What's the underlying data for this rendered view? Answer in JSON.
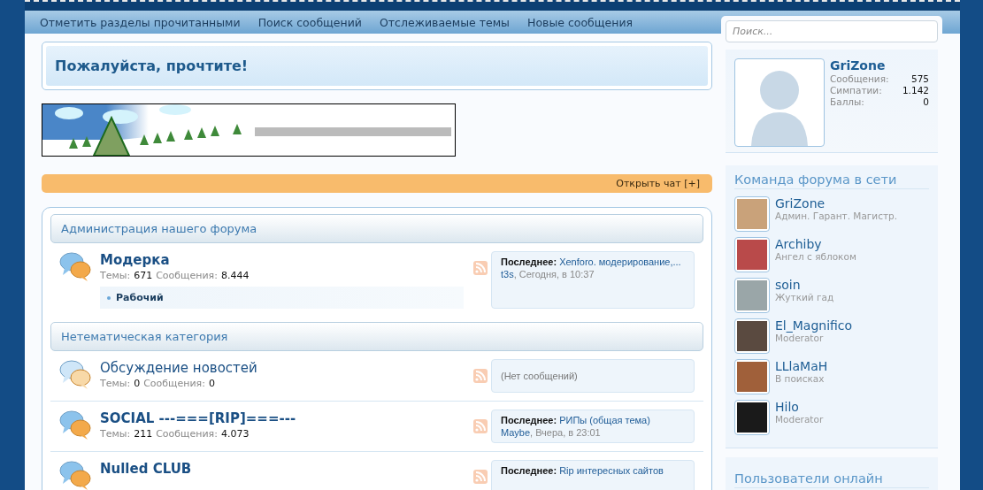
{
  "nav": [
    "Отметить разделы прочитанными",
    "Поиск сообщений",
    "Отслеживаемые темы",
    "Новые сообщения"
  ],
  "notice": {
    "title": "Пожалуйста, прочтите!"
  },
  "chat_button": "Открыть чат [+]",
  "categories": [
    {
      "title": "Администрация нашего форума",
      "nodes": [
        {
          "title": "Модерка",
          "unread": true,
          "stats": [
            {
              "label": "Темы:",
              "value": "671"
            },
            {
              "label": "Сообщения:",
              "value": "8.444"
            }
          ],
          "subforums": [
            "Рабочий"
          ],
          "last_post": {
            "prefix": "Последнее:",
            "title": "Xenforo. модерирование,...",
            "user": "t3s",
            "date": ", Сегодня, в 10:37"
          }
        }
      ]
    },
    {
      "title": "Нетематическая категория",
      "nodes": [
        {
          "title": "Обсуждение новостей",
          "unread": false,
          "stats": [
            {
              "label": "Темы:",
              "value": "0"
            },
            {
              "label": "Сообщения:",
              "value": "0"
            }
          ],
          "empty_text": "(Нет сообщений)"
        },
        {
          "title": "SOCIAL ---===[RIP]===---",
          "unread": true,
          "stats": [
            {
              "label": "Темы:",
              "value": "211"
            },
            {
              "label": "Сообщения:",
              "value": "4.073"
            }
          ],
          "last_post": {
            "prefix": "Последнее:",
            "title": "РИПы (общая тема)",
            "user": "Maybe",
            "date": ", Вчера, в 23:01"
          }
        },
        {
          "title": "Nulled CLUB",
          "unread": true,
          "last_post": {
            "prefix": "Последнее:",
            "title": "Rip интересных сайтов"
          }
        }
      ]
    }
  ],
  "sidebar": {
    "search": {
      "placeholder": "Поиск..."
    },
    "visitor": {
      "name": "GriZone",
      "stats": [
        {
          "label": "Сообщения:",
          "value": "575"
        },
        {
          "label": "Симпатии:",
          "value": "1.142"
        },
        {
          "label": "Баллы:",
          "value": "0"
        }
      ]
    },
    "team": {
      "title": "Команда форума в сети",
      "members": [
        {
          "name": "GriZone",
          "title": "Админ. Гарант. Магистр."
        },
        {
          "name": "Archiby",
          "title": "Ангел с яблоком"
        },
        {
          "name": "soin",
          "title": "Жуткий гад"
        },
        {
          "name": "El_Magnifico",
          "title": "Moderator"
        },
        {
          "name": "LLlaMaH",
          "title": "В поисках"
        },
        {
          "name": "Hilo",
          "title": "Moderator"
        }
      ]
    },
    "online": {
      "title": "Пользователи онлайн"
    }
  }
}
